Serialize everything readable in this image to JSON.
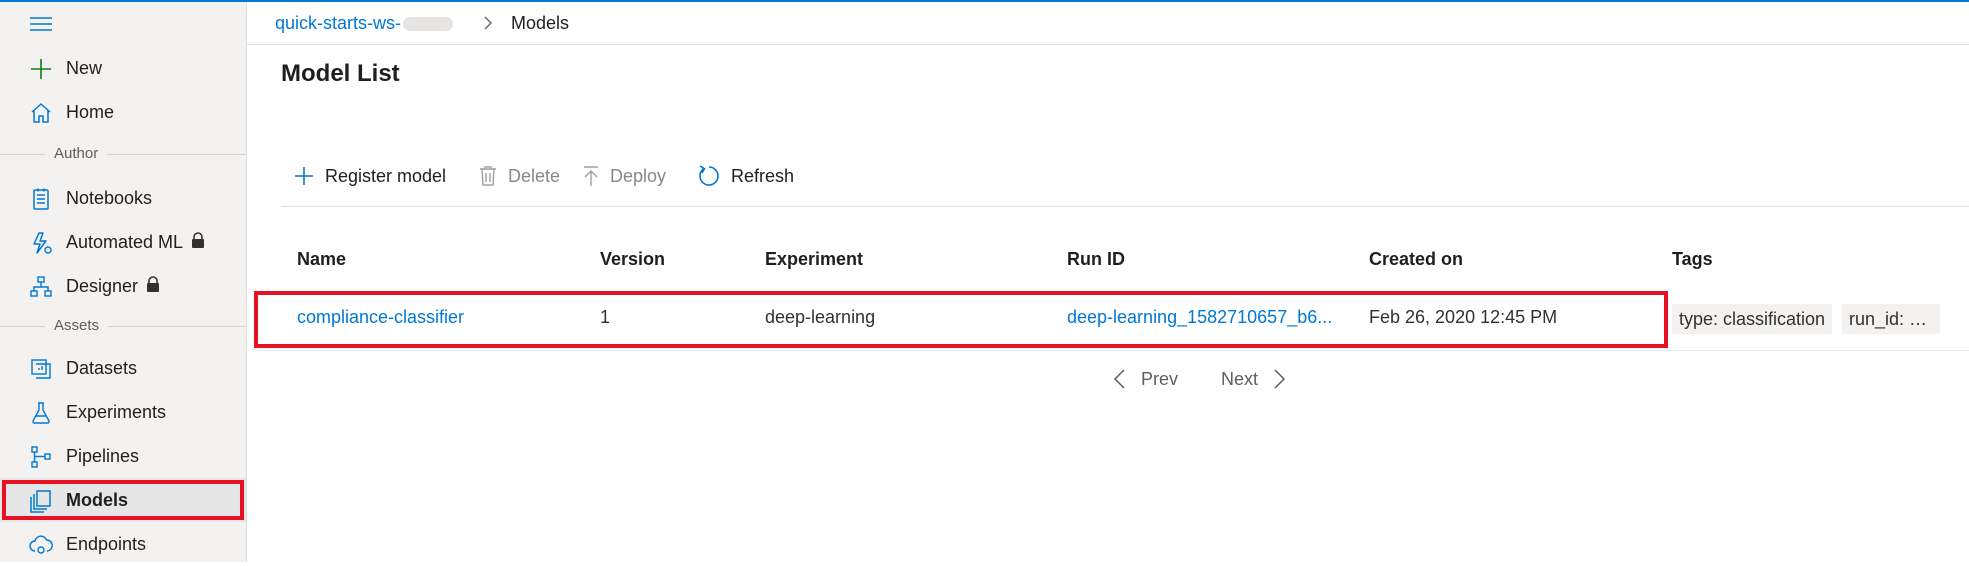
{
  "sidebar": {
    "items": [
      {
        "label": "New",
        "icon": "plus-icon"
      },
      {
        "label": "Home",
        "icon": "home-icon"
      },
      {
        "label": "Notebooks",
        "icon": "notebook-icon"
      },
      {
        "label": "Automated ML",
        "icon": "automated-ml-icon",
        "locked": true
      },
      {
        "label": "Designer",
        "icon": "designer-icon",
        "locked": true
      },
      {
        "label": "Datasets",
        "icon": "datasets-icon"
      },
      {
        "label": "Experiments",
        "icon": "flask-icon"
      },
      {
        "label": "Pipelines",
        "icon": "pipelines-icon"
      },
      {
        "label": "Models",
        "icon": "models-icon",
        "selected": true
      },
      {
        "label": "Endpoints",
        "icon": "endpoints-icon"
      }
    ],
    "sections": {
      "author": "Author",
      "assets": "Assets"
    }
  },
  "breadcrumb": {
    "workspace": "quick-starts-ws-",
    "current": "Models"
  },
  "page": {
    "title": "Model List"
  },
  "toolbar": {
    "register": "Register model",
    "delete": "Delete",
    "deploy": "Deploy",
    "refresh": "Refresh"
  },
  "table": {
    "columns": [
      "Name",
      "Version",
      "Experiment",
      "Run ID",
      "Created on",
      "Tags"
    ],
    "rows": [
      {
        "name": "compliance-classifier",
        "version": "1",
        "experiment": "deep-learning",
        "run_id": "deep-learning_1582710657_b6...",
        "created_on": "Feb 26, 2020 12:45 PM",
        "tags": [
          "type: classification",
          "run_id: d..."
        ]
      }
    ]
  },
  "pager": {
    "prev": "Prev",
    "next": "Next"
  },
  "colors": {
    "accent": "#0078d4",
    "highlight": "#e81123",
    "sidebar_bg": "#f3f2f1"
  }
}
